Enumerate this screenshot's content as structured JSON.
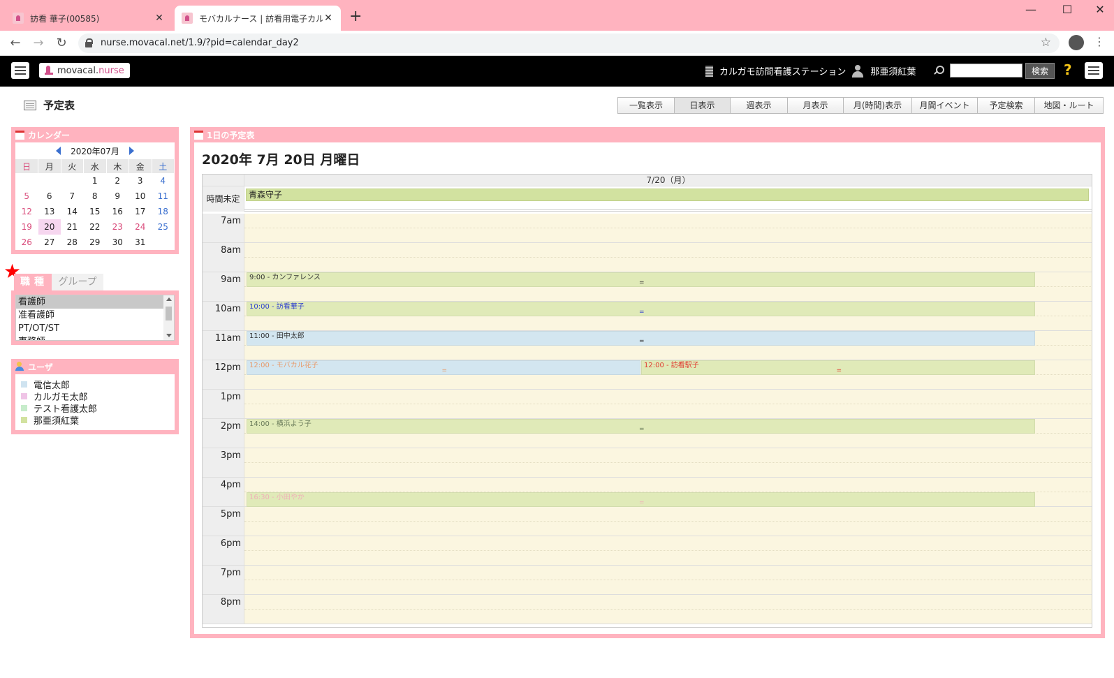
{
  "browser": {
    "tabs": [
      {
        "title": "訪看 華子(00585)",
        "active": false
      },
      {
        "title": "モバカルナース | 訪看用電子カルテ",
        "active": true
      }
    ],
    "url": "nurse.movacal.net/1.9/?pid=calendar_day2"
  },
  "header": {
    "logo_main": "movacal.",
    "logo_sub": "nurse",
    "station": "カルガモ訪問看護ステーション",
    "user": "那亜須紅葉",
    "search_label": "検索",
    "help": "?"
  },
  "page": {
    "title": "予定表",
    "view_tabs": [
      "一覧表示",
      "日表示",
      "週表示",
      "月表示",
      "月(時間)表示",
      "月間イベント",
      "予定検索",
      "地図・ルート"
    ],
    "selected_view": "日表示"
  },
  "calendar_panel": {
    "title": "カレンダー",
    "month": "2020年07月",
    "weekdays": [
      "日",
      "月",
      "火",
      "水",
      "木",
      "金",
      "土"
    ],
    "weeks": [
      [
        "",
        "",
        "",
        "1",
        "2",
        "3",
        "4"
      ],
      [
        "5",
        "6",
        "7",
        "8",
        "9",
        "10",
        "11"
      ],
      [
        "12",
        "13",
        "14",
        "15",
        "16",
        "17",
        "18"
      ],
      [
        "19",
        "20",
        "21",
        "22",
        "23",
        "24",
        "25"
      ],
      [
        "26",
        "27",
        "28",
        "29",
        "30",
        "31",
        ""
      ]
    ],
    "today": "20",
    "holidays": [
      "23",
      "24"
    ]
  },
  "filter": {
    "tabs": [
      "職種",
      "グループ"
    ],
    "options": [
      "看護師",
      "准看護師",
      "PT/OT/ST",
      "事務師"
    ],
    "selected": "看護師"
  },
  "users_panel": {
    "title": "ユーザ",
    "users": [
      {
        "name": "電信太郎",
        "color": "#cfe3f0"
      },
      {
        "name": "カルガモ太郎",
        "color": "#efc4e6"
      },
      {
        "name": "テスト看護太郎",
        "color": "#c7eccb"
      },
      {
        "name": "那亜須紅葉",
        "color": "#d2e2a0"
      }
    ]
  },
  "day": {
    "panel_title": "1日の予定表",
    "date_title": "2020年 7月 20日 月曜日",
    "column": "7/20（月）",
    "untimed_label": "時間未定",
    "untimed_event": "青森守子",
    "hours": [
      "7am",
      "8am",
      "9am",
      "10am",
      "11am",
      "12pm",
      "1pm",
      "2pm",
      "3pm",
      "4pm",
      "5pm",
      "6pm",
      "7pm",
      "8pm"
    ],
    "events": [
      {
        "label": "9:00 - カンファレンス",
        "start": 9.0,
        "lane": 0,
        "lanes": 1,
        "bg": "#e0eab8",
        "fg": "#333"
      },
      {
        "label": "10:00 - 訪看華子",
        "start": 10.0,
        "lane": 0,
        "lanes": 1,
        "bg": "#e0eab8",
        "fg": "#2e3fcf"
      },
      {
        "label": "11:00 - 田中太郎",
        "start": 11.0,
        "lane": 0,
        "lanes": 1,
        "bg": "#d3e6f0",
        "fg": "#333"
      },
      {
        "label": "12:00 - モバカル花子",
        "start": 12.0,
        "lane": 0,
        "lanes": 2,
        "bg": "#d3e6f0",
        "fg": "#e89a6a"
      },
      {
        "label": "12:00 - 訪看駅子",
        "start": 12.0,
        "lane": 1,
        "lanes": 2,
        "bg": "#e0eab8",
        "fg": "#e0392f"
      },
      {
        "label": "14:00 - 横浜よう子",
        "start": 14.0,
        "lane": 0,
        "lanes": 1,
        "bg": "#e0eab8",
        "fg": "#6a7b5a"
      },
      {
        "label": "16:30 - 小田やか",
        "start": 16.5,
        "lane": 0,
        "lanes": 1,
        "bg": "#e0eab8",
        "fg": "#f0b0b8"
      }
    ]
  }
}
